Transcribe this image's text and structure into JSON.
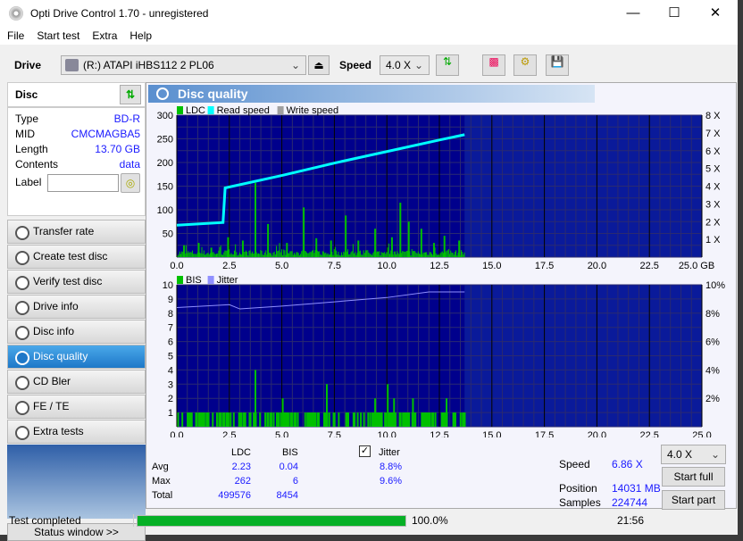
{
  "window": {
    "title": "Opti Drive Control 1.70 - unregistered"
  },
  "menu": [
    "File",
    "Start test",
    "Extra",
    "Help"
  ],
  "toolbar": {
    "drive_label": "Drive",
    "drive_value": "(R:)   ATAPI iHBS112   2 PL06",
    "speed_label": "Speed",
    "speed_value": "4.0 X"
  },
  "disc": {
    "title": "Disc",
    "type_label": "Type",
    "type": "BD-R",
    "mid_label": "MID",
    "mid": "CMCMAGBA5",
    "length_label": "Length",
    "length": "13.70 GB",
    "contents_label": "Contents",
    "contents": "data",
    "label_label": "Label",
    "label_value": ""
  },
  "nav": [
    {
      "label": "Transfer rate"
    },
    {
      "label": "Create test disc"
    },
    {
      "label": "Verify test disc"
    },
    {
      "label": "Drive info"
    },
    {
      "label": "Disc info"
    },
    {
      "label": "Disc quality",
      "active": true
    },
    {
      "label": "CD Bler"
    },
    {
      "label": "FE / TE"
    },
    {
      "label": "Extra tests"
    }
  ],
  "status_window": "Status window >>",
  "panel_title": "Disc quality",
  "chart_data": [
    {
      "type": "bar+line",
      "legend": [
        "LDC",
        "Read speed",
        "Write speed"
      ],
      "colors": {
        "LDC": "#00c000",
        "Read speed": "#00ffff",
        "Write speed": "#a0a0a0",
        "bg": "#00008c"
      },
      "xlim": [
        0,
        25
      ],
      "xunit": "GB",
      "xticks": [
        "0.0",
        "2.5",
        "5.0",
        "7.5",
        "10.0",
        "12.5",
        "15.0",
        "17.5",
        "20.0",
        "22.5",
        "25.0"
      ],
      "ylim": [
        0,
        300
      ],
      "yticks": [
        "50",
        "100",
        "150",
        "200",
        "250",
        "300"
      ],
      "y2lim": [
        0,
        8
      ],
      "y2ticks": [
        "1 X",
        "2 X",
        "3 X",
        "4 X",
        "5 X",
        "6 X",
        "7 X",
        "8 X"
      ],
      "ldc_spikes": [
        [
          0.3,
          25
        ],
        [
          1.0,
          30
        ],
        [
          1.6,
          20
        ],
        [
          2.4,
          42
        ],
        [
          3.1,
          35
        ],
        [
          3.7,
          157
        ],
        [
          4.3,
          70
        ],
        [
          5.2,
          30
        ],
        [
          6.0,
          105
        ],
        [
          6.6,
          40
        ],
        [
          7.3,
          35
        ],
        [
          8.0,
          88
        ],
        [
          8.6,
          35
        ],
        [
          9.4,
          60
        ],
        [
          10.2,
          42
        ],
        [
          10.6,
          115
        ],
        [
          11.0,
          75
        ],
        [
          11.6,
          60
        ],
        [
          12.2,
          30
        ],
        [
          12.7,
          45
        ],
        [
          13.4,
          35
        ]
      ],
      "read_speed": [
        [
          0,
          1.8
        ],
        [
          2.2,
          1.95
        ],
        [
          2.3,
          3.9
        ],
        [
          5,
          4.6
        ],
        [
          7.5,
          5.3
        ],
        [
          10,
          5.95
        ],
        [
          12.5,
          6.6
        ],
        [
          13.7,
          6.9
        ]
      ]
    },
    {
      "type": "bar+line",
      "legend": [
        "BIS",
        "Jitter"
      ],
      "colors": {
        "BIS": "#00c000",
        "Jitter": "#9090ff"
      },
      "xlim": [
        0,
        25
      ],
      "ylim": [
        0,
        10
      ],
      "yticks": [
        "1",
        "2",
        "3",
        "4",
        "5",
        "6",
        "7",
        "8",
        "9",
        "10"
      ],
      "y2lim": [
        0,
        10
      ],
      "y2ticks": [
        "2%",
        "4%",
        "6%",
        "8%",
        "10%"
      ],
      "bis_spikes": [
        [
          3.7,
          4
        ],
        [
          7.1,
          3
        ],
        [
          5.0,
          2
        ],
        [
          9.4,
          2
        ],
        [
          10.0,
          3
        ],
        [
          10.3,
          2
        ],
        [
          11.2,
          2
        ],
        [
          12.8,
          2
        ]
      ],
      "jitter": [
        [
          0,
          8.4
        ],
        [
          2.5,
          8.6
        ],
        [
          3,
          8.3
        ],
        [
          5,
          8.5
        ],
        [
          7.5,
          8.8
        ],
        [
          10,
          9.1
        ],
        [
          12,
          9.5
        ],
        [
          13.7,
          9.5
        ]
      ]
    }
  ],
  "stats": {
    "ldc": "LDC",
    "bis": "BIS",
    "jitter": "Jitter",
    "jitter_checked": true,
    "avg": "Avg",
    "max": "Max",
    "total": "Total",
    "avg_ldc": "2.23",
    "avg_bis": "0.04",
    "avg_jit": "8.8%",
    "max_ldc": "262",
    "max_bis": "6",
    "max_jit": "9.6%",
    "total_ldc": "499576",
    "total_bis": "8454"
  },
  "right": {
    "speed_label": "Speed",
    "speed": "6.86 X",
    "speed_select": "4.0 X",
    "start_full": "Start full",
    "position_label": "Position",
    "position": "14031 MB",
    "samples_label": "Samples",
    "samples": "224744",
    "start_part": "Start part"
  },
  "status": {
    "text": "Test completed",
    "progress": 100,
    "percent": "100.0%",
    "time": "21:56"
  }
}
